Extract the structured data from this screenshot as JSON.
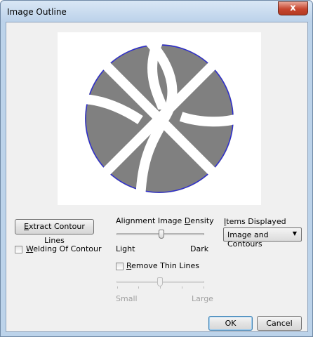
{
  "window": {
    "title": "Image Outline",
    "close_glyph": "x"
  },
  "buttons": {
    "extract_pre": "",
    "extract_u": "E",
    "extract_post": "xtract Contour Lines",
    "ok": "OK",
    "cancel": "Cancel"
  },
  "density": {
    "label_pre": "Alignment Image ",
    "label_u": "D",
    "label_post": "ensity",
    "min_label": "Light",
    "max_label": "Dark",
    "value_fraction": 0.5
  },
  "welding": {
    "pre": "",
    "u": "W",
    "post": "elding Of Contour",
    "checked": false
  },
  "remove_thin": {
    "pre": "",
    "u": "R",
    "post": "emove Thin Lines",
    "checked": false
  },
  "thin_slider": {
    "min_label": "Small",
    "max_label": "Large",
    "value_fraction": 0.5,
    "disabled": true
  },
  "items_displayed": {
    "label_pre": "",
    "label_u": "I",
    "label_post": "tems Displayed",
    "selected": "Image and Contours"
  },
  "colors": {
    "fill": "#808080",
    "outline": "#2b2bd6"
  }
}
